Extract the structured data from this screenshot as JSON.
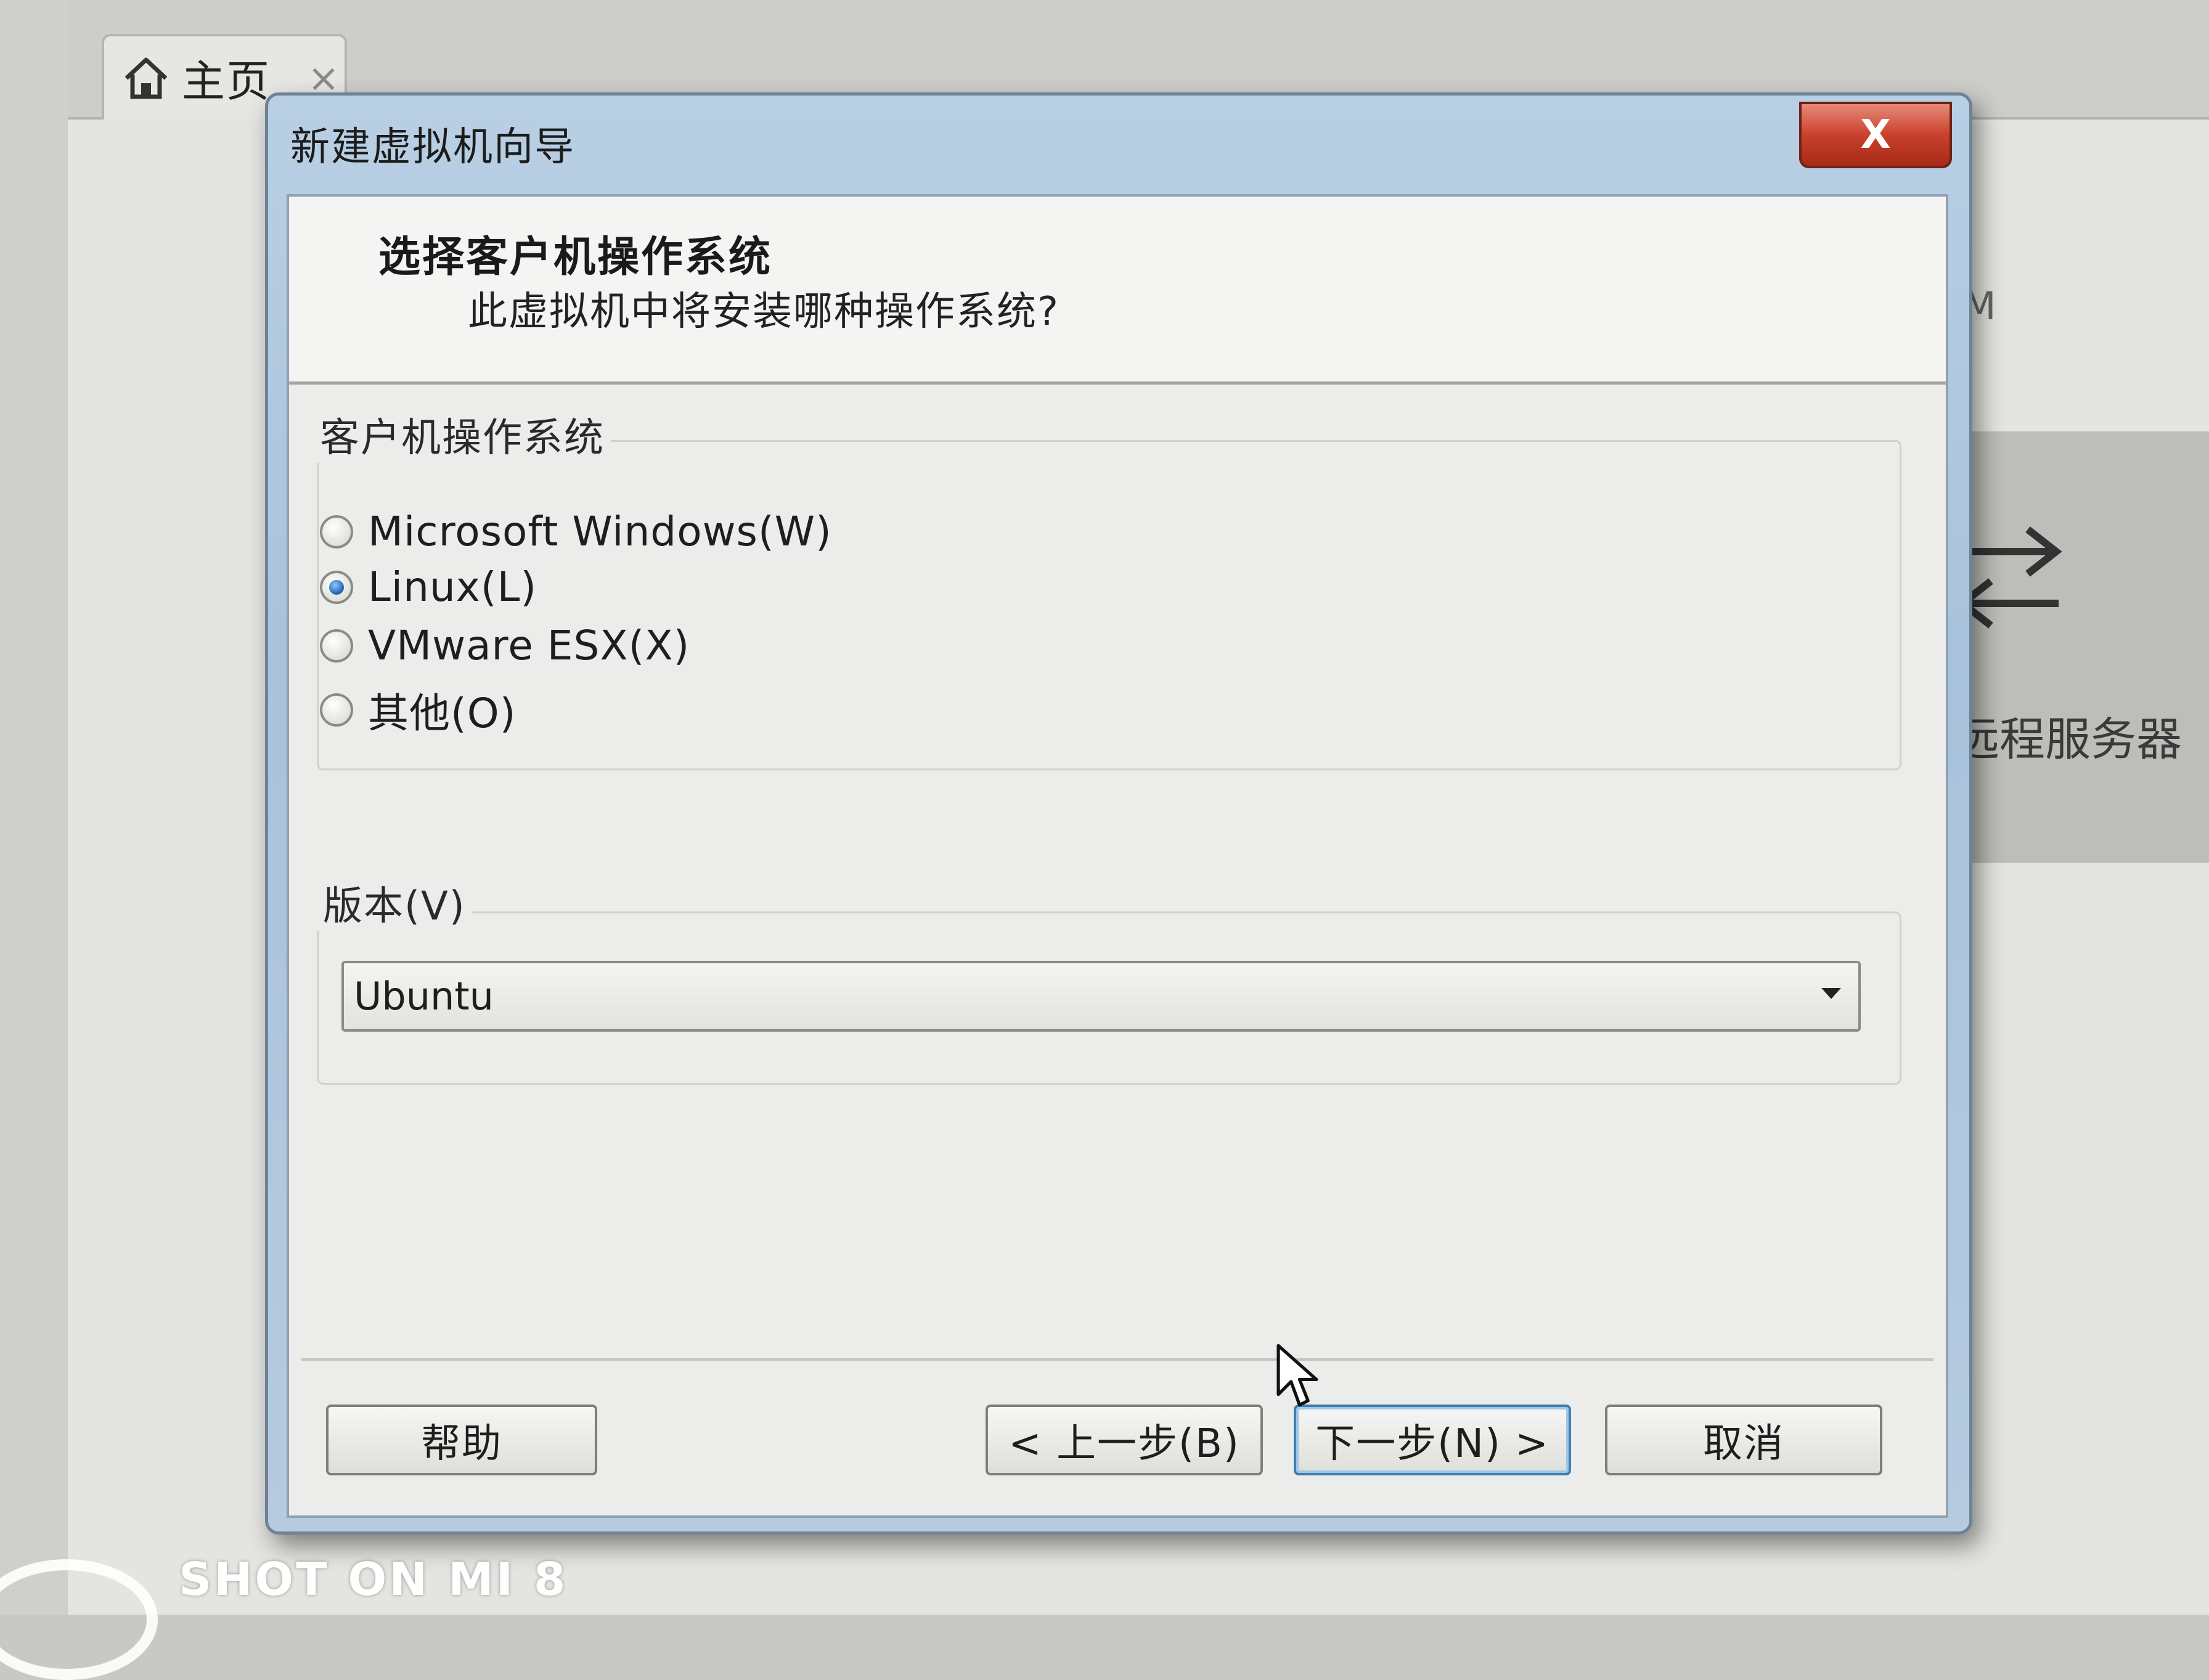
{
  "background_app": {
    "home_tab": {
      "label": "主页",
      "close": "×"
    },
    "right_panel": {
      "letter": "M",
      "remote_server_label": "远程服务器"
    }
  },
  "dialog": {
    "title": "新建虚拟机向导",
    "close": "X",
    "header": {
      "title": "选择客户机操作系统",
      "subtitle": "此虚拟机中将安装哪种操作系统?"
    },
    "guest_os": {
      "group_label": "客户机操作系统",
      "options": [
        {
          "label": "Microsoft Windows(W)",
          "checked": false
        },
        {
          "label": "Linux(L)",
          "checked": true
        },
        {
          "label": "VMware ESX(X)",
          "checked": false
        },
        {
          "label": "其他(O)",
          "checked": false
        }
      ]
    },
    "version": {
      "label": "版本(V)",
      "selected": "Ubuntu"
    },
    "buttons": {
      "help": "帮助",
      "back": "< 上一步(B)",
      "next": "下一步(N) >",
      "cancel": "取消"
    }
  },
  "watermark": "SHOT ON MI 8"
}
